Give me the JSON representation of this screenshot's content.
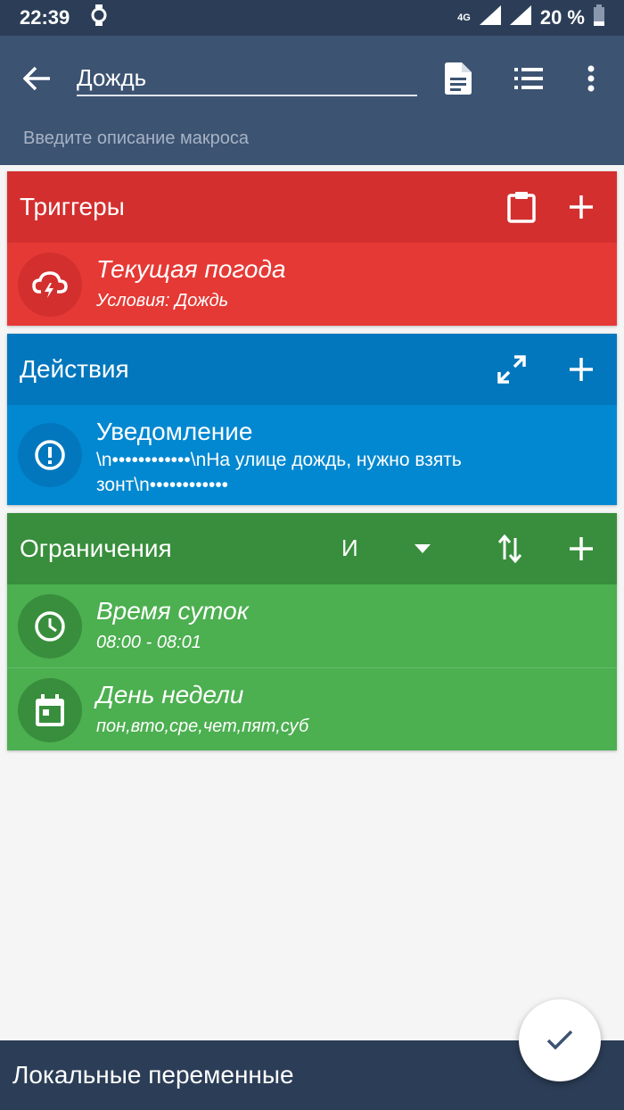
{
  "status_bar": {
    "time": "22:39",
    "network": "4G",
    "battery": "20 %"
  },
  "toolbar": {
    "title_value": "Дождь",
    "description_placeholder": "Введите описание макроса"
  },
  "triggers": {
    "title": "Триггеры",
    "items": [
      {
        "title": "Текущая погода",
        "subtitle": "Условия: Дождь",
        "icon": "cloud-lightning-icon"
      }
    ]
  },
  "actions": {
    "title": "Действия",
    "items": [
      {
        "title": "Уведомление",
        "subtitle": "\\n••••••••••••\\nНа улице дождь, нужно взять зонт\\n••••••••••••",
        "icon": "alert-circle-icon"
      }
    ]
  },
  "constraints": {
    "title": "Ограничения",
    "logic": "И",
    "items": [
      {
        "title": "Время суток",
        "subtitle": "08:00 - 08:01",
        "icon": "clock-icon"
      },
      {
        "title": "День недели",
        "subtitle": "пон,вто,сре,чет,пят,суб",
        "icon": "calendar-icon"
      }
    ]
  },
  "bottom_bar": {
    "label": "Локальные переменные"
  },
  "colors": {
    "toolbar": "#3c5372",
    "status_bar": "#2c3e57",
    "triggers": "#e53935",
    "actions": "#0288d1",
    "constraints": "#4caf50",
    "fab_check": "#3c5372"
  }
}
